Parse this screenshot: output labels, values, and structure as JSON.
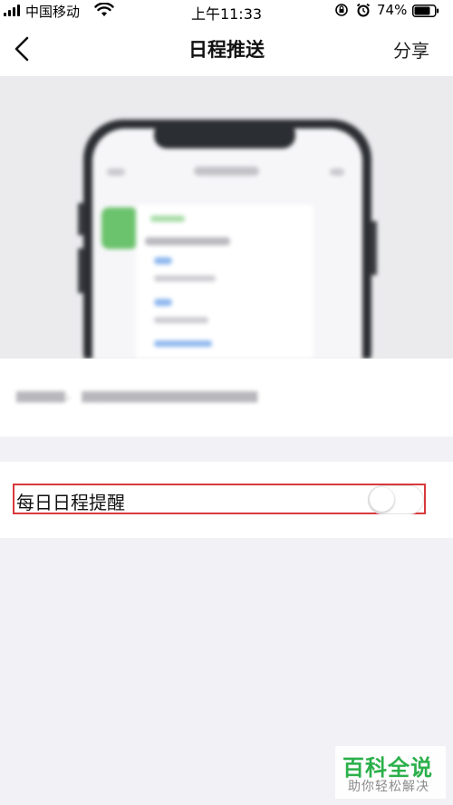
{
  "status_bar": {
    "carrier": "中国移动",
    "time": "上午11:33",
    "battery_percent": "74%"
  },
  "nav": {
    "title": "日程推送",
    "share_label": "分享"
  },
  "setting": {
    "label": "每日日程提醒",
    "enabled": false
  },
  "watermark": {
    "logo": "百科全说",
    "slogan": "助你轻松解决"
  },
  "colors": {
    "highlight": "#d8393c",
    "watermark_green": "#2bb04a"
  }
}
